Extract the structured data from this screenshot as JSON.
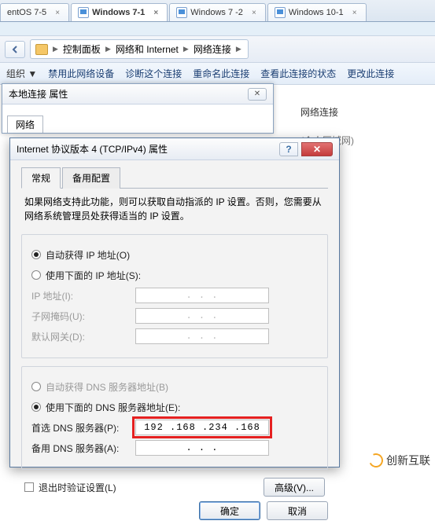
{
  "tabs": [
    {
      "label": "entOS 7-5"
    },
    {
      "label": "Windows 7-1"
    },
    {
      "label": "Windows 7 -2"
    },
    {
      "label": "Windows 10-1"
    }
  ],
  "breadcrumb": {
    "a": "控制面板",
    "b": "网络和 Internet",
    "c": "网络连接"
  },
  "toolbar": {
    "a": "禁用此网络设备",
    "b": "诊断这个连接",
    "c": "重命名此连接",
    "d": "查看此连接的状态",
    "e": "更改此连接"
  },
  "bg": {
    "netconn": "网络连接",
    "pan": "(个人区域网)"
  },
  "win1": {
    "title": "本地连接 属性",
    "tab": "网络"
  },
  "dialog": {
    "title": "Internet 协议版本 4 (TCP/IPv4) 属性",
    "tab_general": "常规",
    "tab_alt": "备用配置",
    "desc": "如果网络支持此功能，则可以获取自动指派的 IP 设置。否则，您需要从网络系统管理员处获得适当的 IP 设置。",
    "ip": {
      "auto": "自动获得 IP 地址(O)",
      "manual": "使用下面的 IP 地址(S):",
      "addr_lbl": "IP 地址(I):",
      "mask_lbl": "子网掩码(U):",
      "gw_lbl": "默认网关(D):",
      "placeholder": ".   .   ."
    },
    "dns": {
      "auto": "自动获得 DNS 服务器地址(B)",
      "manual": "使用下面的 DNS 服务器地址(E):",
      "pref_lbl": "首选 DNS 服务器(P):",
      "alt_lbl": "备用 DNS 服务器(A):",
      "pref_val": "192 .168 .234 .168",
      "alt_placeholder": ".   .   ."
    },
    "exit_validate": "退出时验证设置(L)",
    "advanced": "高级(V)...",
    "ok": "确定",
    "cancel": "取消"
  },
  "watermark": "创新互联"
}
